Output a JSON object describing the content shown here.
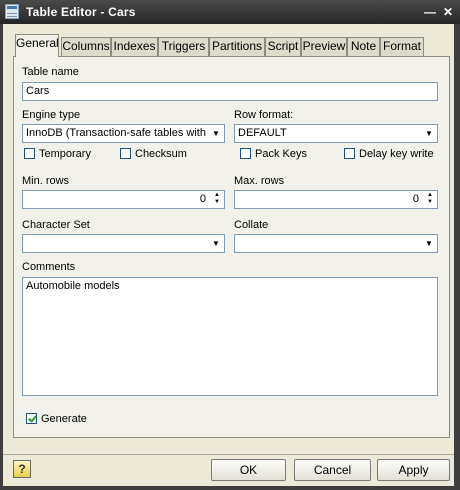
{
  "window": {
    "title": "Table Editor - Cars"
  },
  "tabs": [
    "General",
    "Columns",
    "Indexes",
    "Triggers",
    "Partitions",
    "Script",
    "Preview",
    "Note",
    "Format"
  ],
  "fields": {
    "table_name_label": "Table name",
    "table_name_value": "Cars",
    "engine_type_label": "Engine type",
    "engine_type_value": "InnoDB (Transaction-safe tables with row locking)",
    "row_format_label": "Row format:",
    "row_format_value": "DEFAULT",
    "temporary_label": "Temporary",
    "temporary_checked": false,
    "checksum_label": "Checksum",
    "checksum_checked": false,
    "pack_keys_label": "Pack Keys",
    "pack_keys_checked": false,
    "delay_key_write_label": "Delay key write",
    "delay_key_write_checked": false,
    "min_rows_label": "Min. rows",
    "min_rows_value": "0",
    "max_rows_label": "Max. rows",
    "max_rows_value": "0",
    "character_set_label": "Character Set",
    "character_set_value": "",
    "collate_label": "Collate",
    "collate_value": "",
    "comments_label": "Comments",
    "comments_value": "Automobile models",
    "generate_label": "Generate",
    "generate_checked": true
  },
  "buttons": {
    "ok": "OK",
    "cancel": "Cancel",
    "apply": "Apply",
    "help": "?"
  },
  "icons": {
    "app": "table-grid-icon",
    "minimize": "minimize-icon",
    "close": "close-icon",
    "dropdown": "chevron-down-icon",
    "spin": "spin-arrows-icon",
    "help": "help-icon"
  },
  "colors": {
    "titlebar": "#3e3e3e",
    "dialog_bg": "#ece9d8",
    "panel_bg": "#f3f2ea",
    "border": "#7f9db9",
    "check": "#21a121"
  }
}
